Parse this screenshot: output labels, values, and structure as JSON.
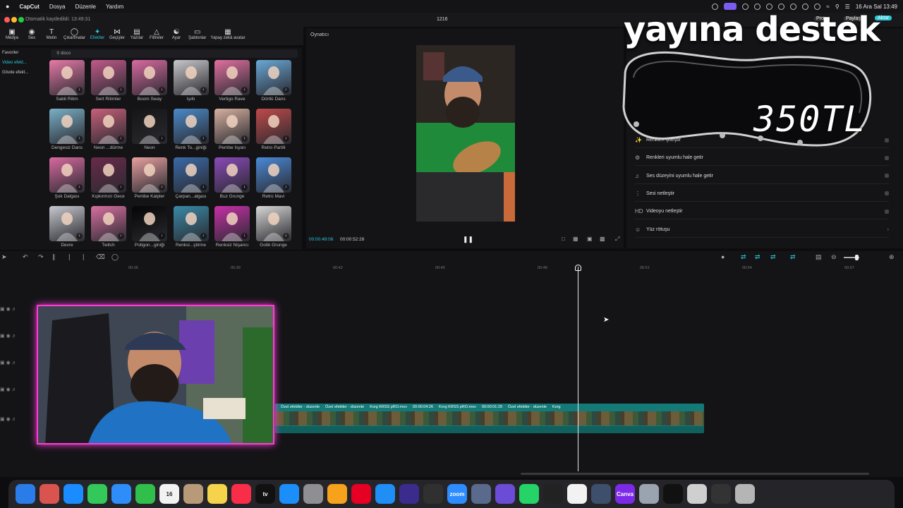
{
  "menubar": {
    "app": "CapCut",
    "items": [
      "Dosya",
      "Düzenle",
      "Yardım"
    ],
    "clock": "16 Ara Sal 13:49"
  },
  "titlebar": {
    "autosave": "Otomatik kaydedildi: 13:49:31",
    "project": "1216",
    "pro": "Pro",
    "share": "Paylaş",
    "export": "Aktar"
  },
  "toolbar": [
    {
      "label": "Medya",
      "icon": "media-icon"
    },
    {
      "label": "Ses",
      "icon": "audio-icon"
    },
    {
      "label": "Metin",
      "icon": "text-icon"
    },
    {
      "label": "Çıkartmalar",
      "icon": "sticker-icon"
    },
    {
      "label": "Efektler",
      "icon": "effects-icon",
      "active": true
    },
    {
      "label": "Geçişler",
      "icon": "transition-icon"
    },
    {
      "label": "Yazılar",
      "icon": "captions-icon"
    },
    {
      "label": "Filtreler",
      "icon": "filter-icon"
    },
    {
      "label": "Ayar",
      "icon": "adjust-icon"
    },
    {
      "label": "Şablonlar",
      "icon": "template-icon"
    },
    {
      "label": "Yapay zekâ avatar",
      "icon": "ai-avatar-icon"
    }
  ],
  "leftnav": [
    "Favoriler",
    "Video efekt...",
    "Gövde efekt..."
  ],
  "search": {
    "value": "disco"
  },
  "effects": [
    [
      "Sabit Ritim",
      "Sert Ritimler",
      "Boom Sway",
      "Işıltı",
      "Vertigo Rave",
      "Dörtlü Dans"
    ],
    [
      "Dengesiz Dans",
      "Neon ...dürme",
      "Neon",
      "Renk To...giniği",
      "Pembe İsyan",
      "Retro Partili"
    ],
    [
      "Şok Dalgası",
      "Kıpkırmızı Gece",
      "Pembe Kalpler",
      "Çarpan...algası",
      "Buz Grunge",
      "Retro Mavi"
    ],
    [
      "Devre",
      "Twitch",
      "Poligon...giniği",
      "Renksi...ştirme",
      "Renksiz Nişancı",
      "Gotik Grunge"
    ]
  ],
  "player": {
    "title": "Oynatıcı",
    "current": "00:00:49:06",
    "total": "00:00:52:28"
  },
  "enhance": [
    {
      "label": "Renkleri iyileştir",
      "icon": "color-enhance-icon"
    },
    {
      "label": "Renkleri uyumlu hale getir",
      "icon": "color-match-icon"
    },
    {
      "label": "Ses düzeyini uyumlu hale getir",
      "icon": "volume-match-icon"
    },
    {
      "label": "Sesi netleştir",
      "icon": "audio-clarify-icon"
    },
    {
      "label": "Videoyu netleştir",
      "icon": "hd-icon"
    },
    {
      "label": "Yüz rötuşu",
      "icon": "face-retouch-icon"
    }
  ],
  "overlay": {
    "title": "yayına destek",
    "price": "350TL"
  },
  "ruler": [
    "00:36",
    "00:39",
    "00:42",
    "00:45",
    "00:48",
    "00:51",
    "00:54",
    "00:57"
  ],
  "clip": {
    "segments": [
      "Özel efektler - düzenle",
      "Özel efektler - düzenle",
      "Korg KRSS pRO.mov",
      "00:00:04:26",
      "Korg KRSS pRO.mov",
      "00:00:01:29",
      "Özel efektler - düzenle",
      "Korg"
    ]
  },
  "colors": {
    "accent": "#29c7d6",
    "clip": "#137a78",
    "webcam_border": "#ff3bd8"
  },
  "dock": [
    {
      "name": "finder-icon",
      "color": "#2a7ce8",
      "text": ""
    },
    {
      "name": "launchpad-icon",
      "color": "#d9534f",
      "text": ""
    },
    {
      "name": "safari-icon",
      "color": "#1a8cff",
      "text": ""
    },
    {
      "name": "messages-icon",
      "color": "#34c759",
      "text": ""
    },
    {
      "name": "mail-icon",
      "color": "#2f8dfa",
      "text": ""
    },
    {
      "name": "facetime-icon",
      "color": "#2fbf4a",
      "text": ""
    },
    {
      "name": "calendar-icon",
      "color": "#f2f2f2",
      "text": "16"
    },
    {
      "name": "contacts-icon",
      "color": "#b89a78",
      "text": ""
    },
    {
      "name": "notes-icon",
      "color": "#f5d34a",
      "text": ""
    },
    {
      "name": "music-icon",
      "color": "#fa2d48",
      "text": ""
    },
    {
      "name": "tv-icon",
      "color": "#111111",
      "text": "tv"
    },
    {
      "name": "appstore-icon",
      "color": "#1c8ef9",
      "text": ""
    },
    {
      "name": "settings-icon",
      "color": "#8e8e93",
      "text": ""
    },
    {
      "name": "pages-icon",
      "color": "#f7a21c",
      "text": ""
    },
    {
      "name": "pinterest-icon",
      "color": "#e60023",
      "text": ""
    },
    {
      "name": "app-icon-blue",
      "color": "#1f8ef5",
      "text": ""
    },
    {
      "name": "masters-player-icon",
      "color": "#3a2b8c",
      "text": ""
    },
    {
      "name": "obs-icon",
      "color": "#303030",
      "text": ""
    },
    {
      "name": "zoom-icon",
      "color": "#2d8cff",
      "text": "zoom"
    },
    {
      "name": "app-icon-gray",
      "color": "#5a6a8c",
      "text": ""
    },
    {
      "name": "app-icon-purple",
      "color": "#6b4cd6",
      "text": ""
    },
    {
      "name": "whatsapp-icon",
      "color": "#25d366",
      "text": ""
    },
    {
      "name": "claquette-icon",
      "color": "#222222",
      "text": ""
    },
    {
      "name": "chatgpt-icon",
      "color": "#f2f2f2",
      "text": ""
    },
    {
      "name": "disk-icon",
      "color": "#3d4f6b",
      "text": ""
    },
    {
      "name": "canva-icon",
      "color": "#7d2ae8",
      "text": "Canva"
    },
    {
      "name": "app-icon-silver",
      "color": "#9aa3b0",
      "text": ""
    },
    {
      "name": "capcut-icon",
      "color": "#111111",
      "text": ""
    },
    {
      "name": "printer-icon",
      "color": "#cfcfcf",
      "text": ""
    },
    {
      "name": "keyboard-icon",
      "color": "#333333",
      "text": ""
    },
    {
      "name": "trash-icon",
      "color": "#b5b5b5",
      "text": ""
    }
  ]
}
